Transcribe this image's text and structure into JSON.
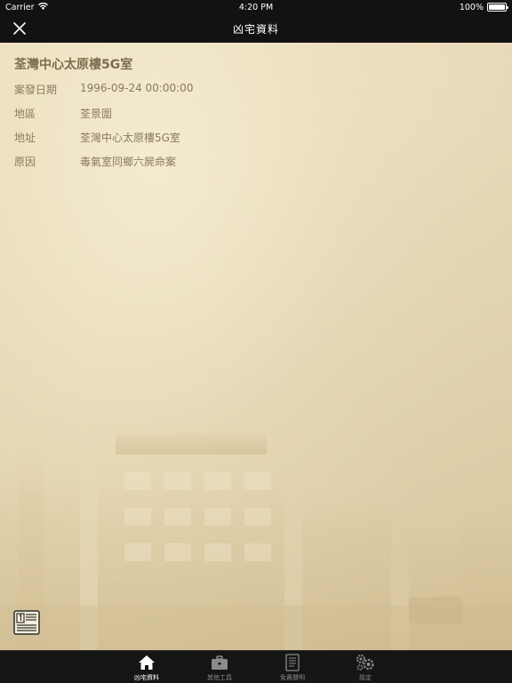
{
  "status_bar": {
    "carrier": "Carrier",
    "time": "4:20 PM",
    "battery": "100%",
    "battery_level": 1.0
  },
  "nav": {
    "title": "凶宅資料",
    "close_icon": "close-icon"
  },
  "record": {
    "title": "荃灣中心太原樓5G室",
    "fields": [
      {
        "label": "案發日期",
        "value": "1996-09-24 00:00:00"
      },
      {
        "label": "地區",
        "value": "荃景圍"
      },
      {
        "label": "地址",
        "value": "荃灣中心太原樓5G室"
      },
      {
        "label": "原因",
        "value": "毒氣室同鄉六屍命案"
      }
    ]
  },
  "news_button": {
    "icon": "newspaper-icon"
  },
  "tabs": [
    {
      "label": "凶宅資料",
      "icon": "home-icon",
      "active": true
    },
    {
      "label": "其他工具",
      "icon": "briefcase-icon",
      "active": false
    },
    {
      "label": "免責聲明",
      "icon": "document-icon",
      "active": false
    },
    {
      "label": "設定",
      "icon": "gears-icon",
      "active": false
    }
  ],
  "colors": {
    "bar_background": "#121212",
    "text_brown": "#8a7a5e",
    "paper": "#efe4c6"
  }
}
